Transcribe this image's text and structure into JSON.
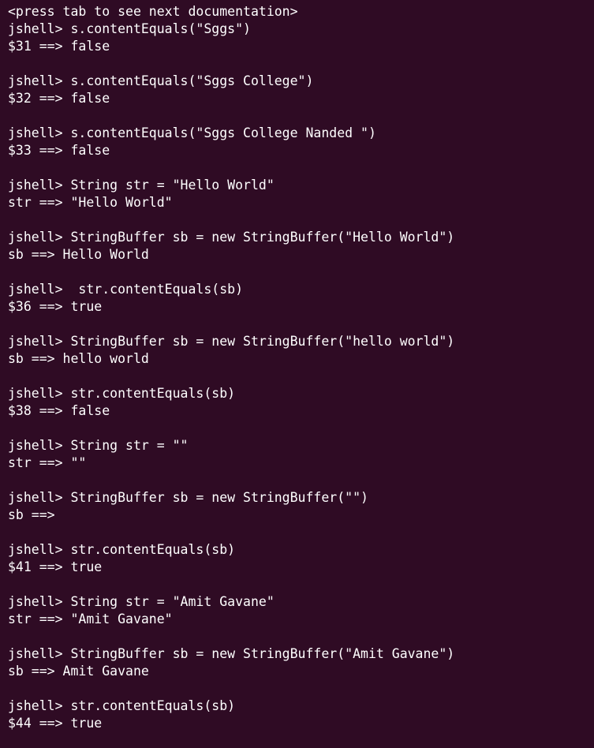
{
  "terminal": {
    "lines": [
      "<press tab to see next documentation>",
      "jshell> s.contentEquals(\"Sggs\")",
      "$31 ==> false",
      "",
      "jshell> s.contentEquals(\"Sggs College\")",
      "$32 ==> false",
      "",
      "jshell> s.contentEquals(\"Sggs College Nanded \")",
      "$33 ==> false",
      "",
      "jshell> String str = \"Hello World\"",
      "str ==> \"Hello World\"",
      "",
      "jshell> StringBuffer sb = new StringBuffer(\"Hello World\")",
      "sb ==> Hello World",
      "",
      "jshell>  str.contentEquals(sb)",
      "$36 ==> true",
      "",
      "jshell> StringBuffer sb = new StringBuffer(\"hello world\")",
      "sb ==> hello world",
      "",
      "jshell> str.contentEquals(sb)",
      "$38 ==> false",
      "",
      "jshell> String str = \"\"",
      "str ==> \"\"",
      "",
      "jshell> StringBuffer sb = new StringBuffer(\"\")",
      "sb ==>",
      "",
      "jshell> str.contentEquals(sb)",
      "$41 ==> true",
      "",
      "jshell> String str = \"Amit Gavane\"",
      "str ==> \"Amit Gavane\"",
      "",
      "jshell> StringBuffer sb = new StringBuffer(\"Amit Gavane\")",
      "sb ==> Amit Gavane",
      "",
      "jshell> str.contentEquals(sb)",
      "$44 ==> true"
    ]
  },
  "colors": {
    "background": "#2f0b24",
    "foreground": "#ffffff"
  }
}
